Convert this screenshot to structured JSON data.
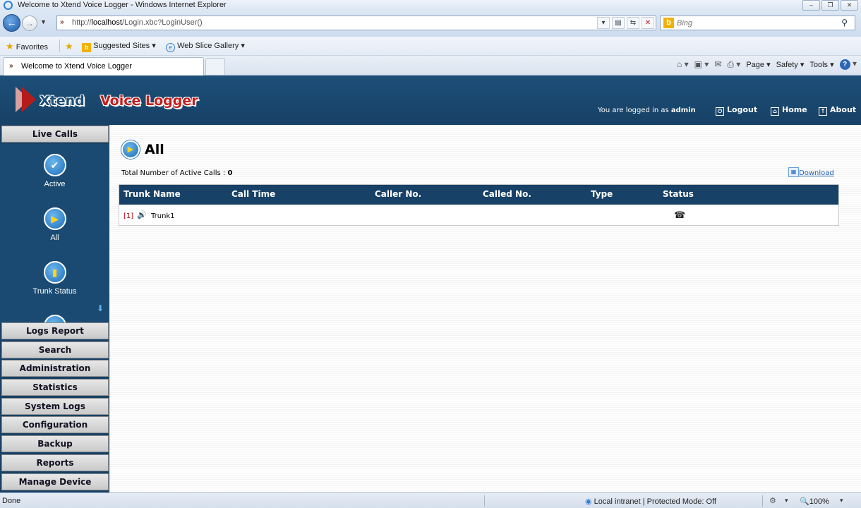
{
  "browser": {
    "window_title": "Welcome to Xtend Voice Logger - Windows Internet Explorer",
    "window_buttons": [
      "–",
      "❐",
      "✕"
    ],
    "url_prefix": "http://",
    "url_host": "localhost",
    "url_path": "/Login.xbc?LoginUser()",
    "search_placeholder": "Bing",
    "favorites_label": "Favorites",
    "suggested_sites_label": "Suggested Sites ▾",
    "web_slice_label": "Web Slice Gallery ▾",
    "tab_title": "Welcome to Xtend Voice Logger",
    "commands": {
      "page": "Page ▾",
      "safety": "Safety ▾",
      "tools": "Tools ▾"
    },
    "status_text": "Done",
    "zone_text": "Local intranet | Protected Mode: Off",
    "zoom_text": "100%"
  },
  "header": {
    "logo_word1": "Xtend",
    "logo_word2": "Voice Logger",
    "logged_in_prefix": "You are logged in as",
    "username": "admin",
    "logout_label": "Logout",
    "home_label": "Home",
    "about_label": "About"
  },
  "sidebar": {
    "live_calls_label": "Live Calls",
    "live_items": [
      {
        "label": "Active",
        "icon": "check-icon"
      },
      {
        "label": "All",
        "icon": "play-icon"
      },
      {
        "label": "Trunk Status",
        "icon": "trunk-status-icon"
      }
    ],
    "menu": [
      "Logs Report",
      "Search",
      "Administration",
      "Statistics",
      "System Logs",
      "Configuration",
      "Backup",
      "Reports",
      "Manage Device"
    ]
  },
  "main": {
    "heading": "All",
    "total_label": "Total Number of Active Calls :",
    "total_value": "0",
    "download_label": "Download",
    "columns": [
      "Trunk Name",
      "Call Time",
      "Caller No.",
      "Called No.",
      "Type",
      "Status"
    ],
    "rows": [
      {
        "index": "[1]",
        "trunk": "Trunk1",
        "call_time": "",
        "caller": "",
        "called": "",
        "type": "",
        "status_icon": "phone-icon"
      }
    ]
  }
}
